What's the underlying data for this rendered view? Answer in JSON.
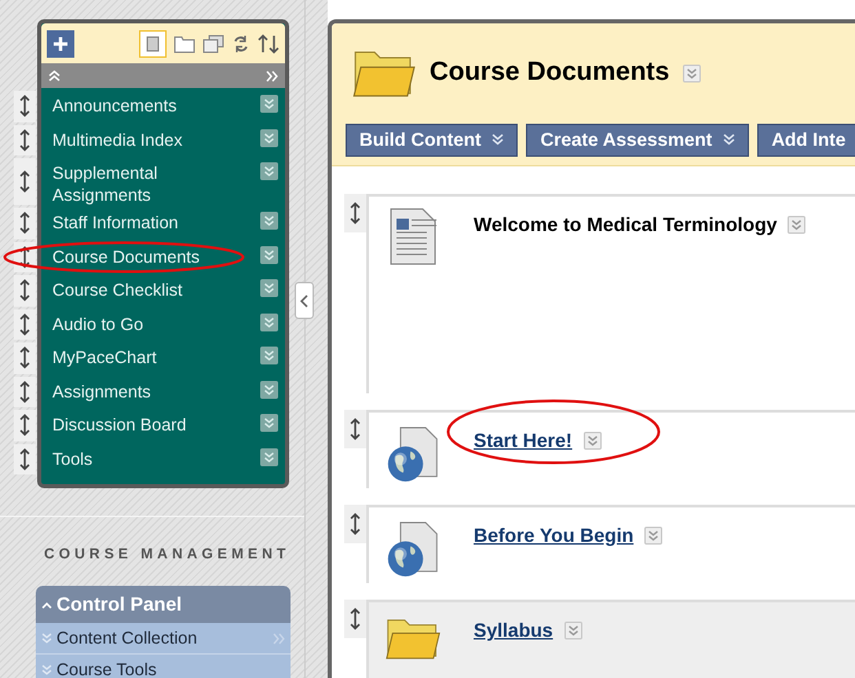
{
  "course_menu": {
    "items": [
      {
        "label": "Announcements",
        "circled": false
      },
      {
        "label": "Multimedia Index",
        "circled": false
      },
      {
        "label": "Supplemental Assignments",
        "circled": false
      },
      {
        "label": "Staff Information",
        "circled": false
      },
      {
        "label": "Course Documents",
        "circled": true
      },
      {
        "label": "Course Checklist",
        "circled": false
      },
      {
        "label": "Audio to Go",
        "circled": false
      },
      {
        "label": "MyPaceChart",
        "circled": false
      },
      {
        "label": "Assignments",
        "circled": false
      },
      {
        "label": "Discussion Board",
        "circled": false
      },
      {
        "label": "Tools",
        "circled": false
      }
    ]
  },
  "course_management": {
    "heading": "COURSE MANAGEMENT",
    "control_panel": {
      "title": "Control Panel",
      "items": [
        {
          "label": "Content Collection"
        },
        {
          "label": "Course Tools"
        }
      ]
    }
  },
  "page": {
    "title": "Course Documents",
    "buttons": [
      {
        "label": "Build Content"
      },
      {
        "label": "Create Assessment"
      },
      {
        "label": "Add Inte"
      }
    ],
    "items": [
      {
        "kind": "document",
        "title": "Welcome to Medical Terminology",
        "circled": false,
        "highlighted": false
      },
      {
        "kind": "link",
        "title": "Start Here!",
        "circled": true,
        "highlighted": false
      },
      {
        "kind": "link",
        "title": "Before You Begin",
        "circled": false,
        "highlighted": false
      },
      {
        "kind": "folder",
        "title": "Syllabus",
        "circled": false,
        "highlighted": true
      }
    ]
  }
}
